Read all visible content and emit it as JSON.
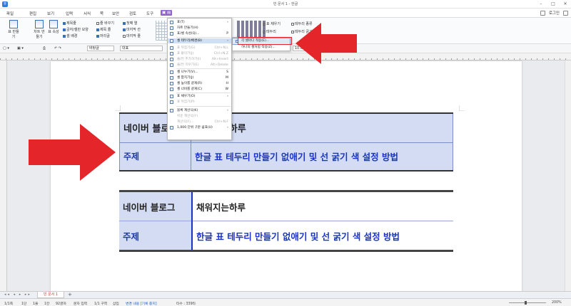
{
  "window": {
    "title": "빈 문서 1 - 한글",
    "controls": [
      "–",
      "□",
      "✕"
    ]
  },
  "menubar": {
    "items": [
      "파일",
      "편집",
      "보기",
      "입력",
      "서식",
      "쪽",
      "보안",
      "검토",
      "도구"
    ],
    "login": "로그인"
  },
  "ribbon": {
    "big_buttons": [
      "표 만들기",
      "차트 만들기",
      "표 속성"
    ],
    "checks_col1": [
      "제목줄",
      "글자/셀만 모양",
      "셀 배경"
    ],
    "checks_col2": [
      "줄 바꾸기",
      "제목 줄",
      "머리글"
    ],
    "checks_col3": [
      "첫째 열",
      "마지막 칸",
      "마지막 줄"
    ],
    "right_items": [
      "표 채우기",
      "테두리",
      "테두리 종류",
      "테두리 굵기"
    ]
  },
  "toolbar2": {
    "style_box": "바탕글",
    "font_box": "대표",
    "size_box": "10.0"
  },
  "dropdown": {
    "items": [
      {
        "label": "표(T)",
        "shortcut": "",
        "disabled": false
      },
      {
        "label": "차트 만들기(H)",
        "shortcut": "",
        "disabled": false
      },
      {
        "label": "표/셀 속성(Q)...",
        "shortcut": "P",
        "disabled": false
      },
      {
        "label": "셀 테두리/배경(B)",
        "shortcut": "",
        "disabled": false,
        "highlight": true
      },
      {
        "label": "표 뒤집기(G)",
        "shortcut": "Ctrl+N,L",
        "disabled": true
      },
      {
        "label": "표 붙이기(J)",
        "shortcut": "Ctrl+N,Z",
        "disabled": true
      },
      {
        "label": "줄/칸 추가하기(I)",
        "shortcut": "Alt+Insert",
        "disabled": true
      },
      {
        "label": "줄/칸 지우기(E)",
        "shortcut": "Alt+Delete",
        "disabled": true
      },
      {
        "label": "셀 나누기(V)...",
        "shortcut": "S",
        "disabled": false
      },
      {
        "label": "셀 합치기(J)",
        "shortcut": "M",
        "disabled": false
      },
      {
        "label": "셀 높이를 같게(R)",
        "shortcut": "H",
        "disabled": false
      },
      {
        "label": "셀 너비를 같게(C)",
        "shortcut": "W",
        "disabled": false
      },
      {
        "label": "표 채우기(O)",
        "shortcut": "",
        "disabled": false
      },
      {
        "label": "표 뒤집기(P)",
        "shortcut": "",
        "disabled": true
      },
      {
        "label": "블록 계산식(K)",
        "shortcut": "",
        "disabled": false
      },
      {
        "label": "쉬운 계산식(Y)",
        "shortcut": "",
        "disabled": true
      },
      {
        "label": "계산식(F)...",
        "shortcut": "Ctrl+N,F",
        "disabled": true
      },
      {
        "label": "1,000 단위 구분 쉼표(U)",
        "shortcut": "",
        "disabled": false
      }
    ]
  },
  "submenu": {
    "items": [
      "각 셀마다 적용(E)...",
      "하나의 셀처럼 적용(Z)..."
    ]
  },
  "table1": {
    "row1": {
      "head": "네이버 블로그",
      "value": "채워지는하루"
    },
    "row2": {
      "head": "주제",
      "value": "한글 표 테두리 만들기 없애기 및 선 굵기 색 설정 방법"
    }
  },
  "table2": {
    "row1": {
      "head": "네이버 블로그",
      "value": "채워지는하루"
    },
    "row2": {
      "head": "주제",
      "value": "한글 표 테두리 만들기 없애기 및 선 굵기 색 설정 방법"
    }
  },
  "tabs": {
    "doc_tab": "빈 문서 1",
    "add": "+"
  },
  "statusbar": {
    "items": [
      "1/1쪽",
      "1단",
      "1줄",
      "1칸",
      "92글자",
      "문자 입력",
      "1/1 구역",
      "삽입"
    ],
    "change_tracking": "변경 내용 [기록 중지]",
    "other": "타수 : 339타",
    "zoom": "200%"
  },
  "colors": {
    "accent": "#8f63c9",
    "arrow": "#e4262b",
    "table_fill": "#d3dcf3",
    "blue_text": "#1a34c9"
  }
}
